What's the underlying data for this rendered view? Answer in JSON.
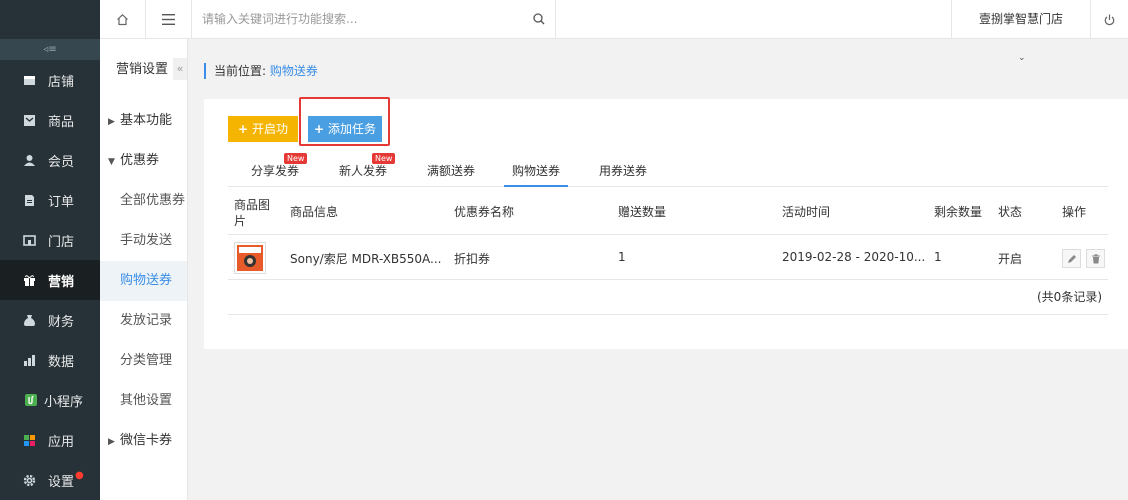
{
  "sidebar": {
    "items": [
      {
        "label": "店铺",
        "icon": "store-icon"
      },
      {
        "label": "商品",
        "icon": "goods-icon"
      },
      {
        "label": "会员",
        "icon": "member-icon"
      },
      {
        "label": "订单",
        "icon": "order-icon"
      },
      {
        "label": "门店",
        "icon": "shop-icon"
      },
      {
        "label": "营销",
        "icon": "gift-icon"
      },
      {
        "label": "财务",
        "icon": "money-bag-icon"
      },
      {
        "label": "数据",
        "icon": "bar-chart-icon"
      },
      {
        "label": "小程序",
        "icon": "mini-program-icon"
      },
      {
        "label": "应用",
        "icon": "apps-icon"
      },
      {
        "label": "设置",
        "icon": "gear-icon"
      }
    ],
    "toggle_glyph": "◃≡"
  },
  "subnav": {
    "title": "营销设置",
    "collapse_glyph": "«",
    "items": [
      {
        "label": "基本功能",
        "type": "group-collapsed"
      },
      {
        "label": "优惠券",
        "type": "group-expanded"
      },
      {
        "label": "全部优惠券",
        "type": "item"
      },
      {
        "label": "手动发送",
        "type": "item"
      },
      {
        "label": "购物送券",
        "type": "item-active"
      },
      {
        "label": "发放记录",
        "type": "item"
      },
      {
        "label": "分类管理",
        "type": "item"
      },
      {
        "label": "其他设置",
        "type": "item"
      },
      {
        "label": "微信卡券",
        "type": "group-collapsed"
      }
    ]
  },
  "topbar": {
    "search_placeholder": "请输入关键词进行功能搜索...",
    "store_name": "壹捌掌智慧门店"
  },
  "breadcrumb": {
    "prefix": "当前位置:",
    "current": "购物送券"
  },
  "actions": {
    "enable_label": "开启功能",
    "add_task_label": "添加任务"
  },
  "tabs": [
    {
      "label": "分享发券",
      "badge": "New"
    },
    {
      "label": "新人发券",
      "badge": "New"
    },
    {
      "label": "满额送券",
      "badge": ""
    },
    {
      "label": "购物送券",
      "badge": ""
    },
    {
      "label": "用券送券",
      "badge": ""
    }
  ],
  "table": {
    "headers": [
      "商品图片",
      "商品信息",
      "优惠券名称",
      "赠送数量",
      "活动时间",
      "剩余数量",
      "状态",
      "操作"
    ],
    "rows": [
      {
        "product": "Sony/索尼 MDR-XB550A...",
        "coupon": "折扣券",
        "quantity": "1",
        "time": "2019-02-28 - 2020-10...",
        "remaining": "1",
        "status": "开启"
      }
    ],
    "footer": "(共0条记录)"
  },
  "colors": {
    "accent": "#3a8ee6",
    "sidebar_bg": "#263238",
    "yellow_button": "#f5b400",
    "blue_button": "#4a9fe3",
    "highlight_border": "#e53935"
  }
}
